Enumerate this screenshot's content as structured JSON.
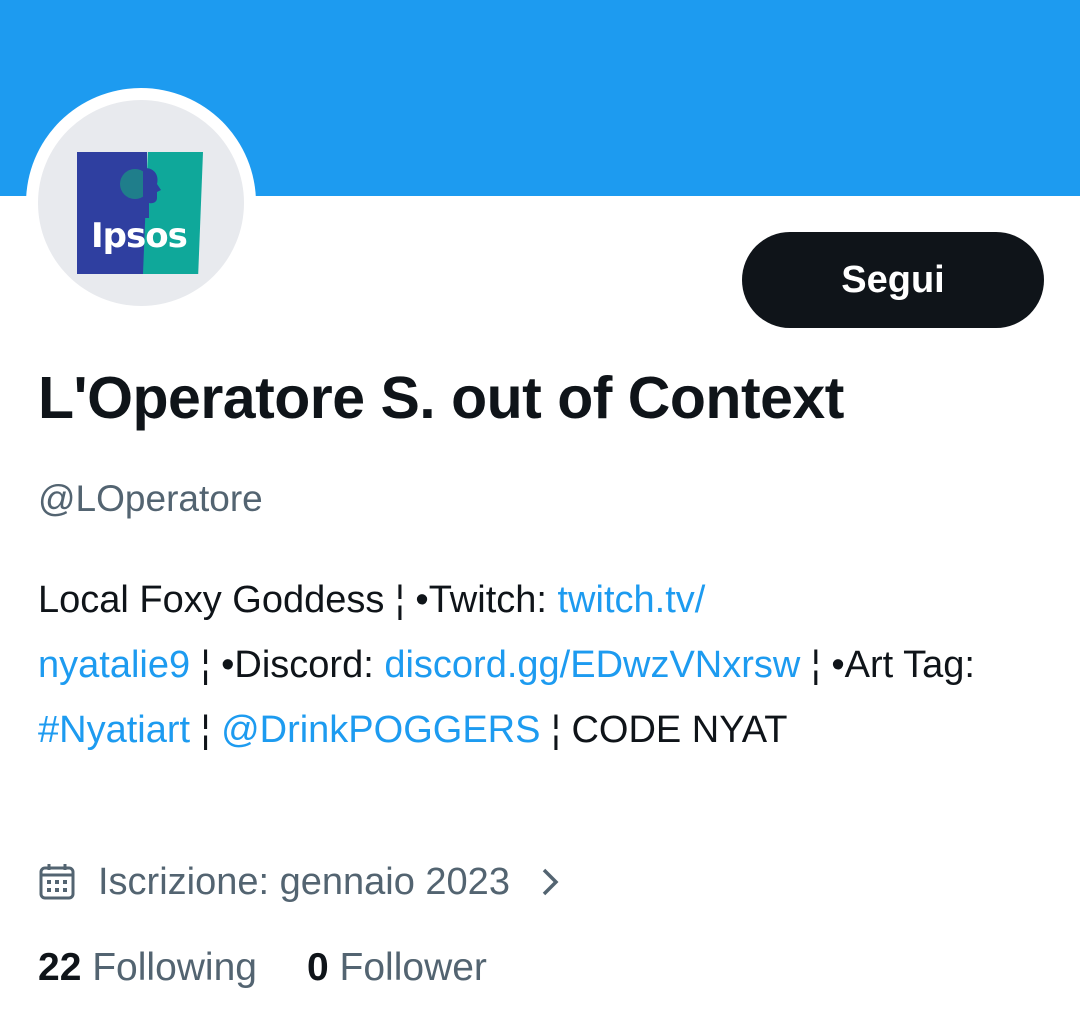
{
  "profile": {
    "avatar_text": "Ipsos",
    "follow_label": "Segui",
    "display_name": "L'Operatore S. out of Context",
    "handle": "@LOperatore",
    "bio": {
      "t1": "Local Foxy Goddess  ¦ •Twitch: ",
      "l1a": "twitch.tv/",
      "l1b": "nyatalie9",
      "t2": " ¦ •Discord: ",
      "l2": "discord.gg/EDwzVNxrsw",
      "t3": " ¦ •Art Tag: ",
      "l3": "#Nyatiart",
      "t4": " ¦ ",
      "l4": "@DrinkPOGGERS",
      "t5": " ¦ CODE NYAT"
    },
    "joined": "Iscrizione: gennaio 2023",
    "following_count": "22",
    "following_label": "Following",
    "follower_count": "0",
    "follower_label": "Follower"
  },
  "colors": {
    "banner": "#1d9bf0",
    "link": "#1d9bf0",
    "button_bg": "#0f1419"
  },
  "icons": [
    "calendar-icon",
    "chevron-right-icon"
  ]
}
